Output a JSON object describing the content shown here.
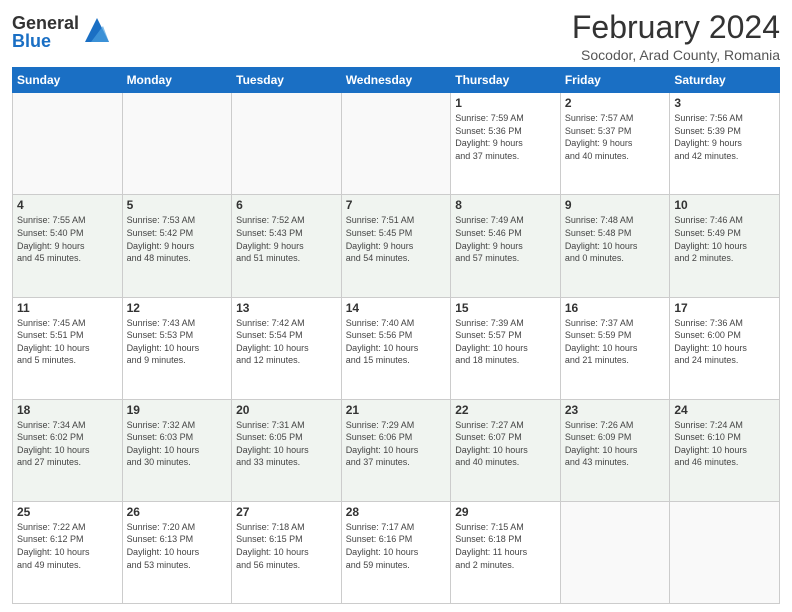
{
  "logo": {
    "general": "General",
    "blue": "Blue"
  },
  "title": "February 2024",
  "location": "Socodor, Arad County, Romania",
  "days_of_week": [
    "Sunday",
    "Monday",
    "Tuesday",
    "Wednesday",
    "Thursday",
    "Friday",
    "Saturday"
  ],
  "weeks": [
    [
      {
        "day": "",
        "info": ""
      },
      {
        "day": "",
        "info": ""
      },
      {
        "day": "",
        "info": ""
      },
      {
        "day": "",
        "info": ""
      },
      {
        "day": "1",
        "info": "Sunrise: 7:59 AM\nSunset: 5:36 PM\nDaylight: 9 hours\nand 37 minutes."
      },
      {
        "day": "2",
        "info": "Sunrise: 7:57 AM\nSunset: 5:37 PM\nDaylight: 9 hours\nand 40 minutes."
      },
      {
        "day": "3",
        "info": "Sunrise: 7:56 AM\nSunset: 5:39 PM\nDaylight: 9 hours\nand 42 minutes."
      }
    ],
    [
      {
        "day": "4",
        "info": "Sunrise: 7:55 AM\nSunset: 5:40 PM\nDaylight: 9 hours\nand 45 minutes."
      },
      {
        "day": "5",
        "info": "Sunrise: 7:53 AM\nSunset: 5:42 PM\nDaylight: 9 hours\nand 48 minutes."
      },
      {
        "day": "6",
        "info": "Sunrise: 7:52 AM\nSunset: 5:43 PM\nDaylight: 9 hours\nand 51 minutes."
      },
      {
        "day": "7",
        "info": "Sunrise: 7:51 AM\nSunset: 5:45 PM\nDaylight: 9 hours\nand 54 minutes."
      },
      {
        "day": "8",
        "info": "Sunrise: 7:49 AM\nSunset: 5:46 PM\nDaylight: 9 hours\nand 57 minutes."
      },
      {
        "day": "9",
        "info": "Sunrise: 7:48 AM\nSunset: 5:48 PM\nDaylight: 10 hours\nand 0 minutes."
      },
      {
        "day": "10",
        "info": "Sunrise: 7:46 AM\nSunset: 5:49 PM\nDaylight: 10 hours\nand 2 minutes."
      }
    ],
    [
      {
        "day": "11",
        "info": "Sunrise: 7:45 AM\nSunset: 5:51 PM\nDaylight: 10 hours\nand 5 minutes."
      },
      {
        "day": "12",
        "info": "Sunrise: 7:43 AM\nSunset: 5:53 PM\nDaylight: 10 hours\nand 9 minutes."
      },
      {
        "day": "13",
        "info": "Sunrise: 7:42 AM\nSunset: 5:54 PM\nDaylight: 10 hours\nand 12 minutes."
      },
      {
        "day": "14",
        "info": "Sunrise: 7:40 AM\nSunset: 5:56 PM\nDaylight: 10 hours\nand 15 minutes."
      },
      {
        "day": "15",
        "info": "Sunrise: 7:39 AM\nSunset: 5:57 PM\nDaylight: 10 hours\nand 18 minutes."
      },
      {
        "day": "16",
        "info": "Sunrise: 7:37 AM\nSunset: 5:59 PM\nDaylight: 10 hours\nand 21 minutes."
      },
      {
        "day": "17",
        "info": "Sunrise: 7:36 AM\nSunset: 6:00 PM\nDaylight: 10 hours\nand 24 minutes."
      }
    ],
    [
      {
        "day": "18",
        "info": "Sunrise: 7:34 AM\nSunset: 6:02 PM\nDaylight: 10 hours\nand 27 minutes."
      },
      {
        "day": "19",
        "info": "Sunrise: 7:32 AM\nSunset: 6:03 PM\nDaylight: 10 hours\nand 30 minutes."
      },
      {
        "day": "20",
        "info": "Sunrise: 7:31 AM\nSunset: 6:05 PM\nDaylight: 10 hours\nand 33 minutes."
      },
      {
        "day": "21",
        "info": "Sunrise: 7:29 AM\nSunset: 6:06 PM\nDaylight: 10 hours\nand 37 minutes."
      },
      {
        "day": "22",
        "info": "Sunrise: 7:27 AM\nSunset: 6:07 PM\nDaylight: 10 hours\nand 40 minutes."
      },
      {
        "day": "23",
        "info": "Sunrise: 7:26 AM\nSunset: 6:09 PM\nDaylight: 10 hours\nand 43 minutes."
      },
      {
        "day": "24",
        "info": "Sunrise: 7:24 AM\nSunset: 6:10 PM\nDaylight: 10 hours\nand 46 minutes."
      }
    ],
    [
      {
        "day": "25",
        "info": "Sunrise: 7:22 AM\nSunset: 6:12 PM\nDaylight: 10 hours\nand 49 minutes."
      },
      {
        "day": "26",
        "info": "Sunrise: 7:20 AM\nSunset: 6:13 PM\nDaylight: 10 hours\nand 53 minutes."
      },
      {
        "day": "27",
        "info": "Sunrise: 7:18 AM\nSunset: 6:15 PM\nDaylight: 10 hours\nand 56 minutes."
      },
      {
        "day": "28",
        "info": "Sunrise: 7:17 AM\nSunset: 6:16 PM\nDaylight: 10 hours\nand 59 minutes."
      },
      {
        "day": "29",
        "info": "Sunrise: 7:15 AM\nSunset: 6:18 PM\nDaylight: 11 hours\nand 2 minutes."
      },
      {
        "day": "",
        "info": ""
      },
      {
        "day": "",
        "info": ""
      }
    ]
  ]
}
